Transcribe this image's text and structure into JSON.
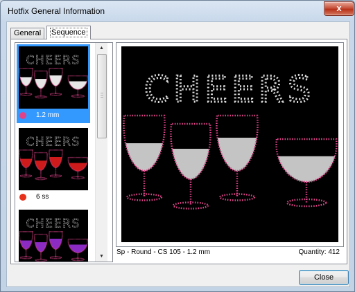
{
  "window": {
    "title": "Hotfix General Information",
    "close_glyph": "x"
  },
  "tabs": [
    {
      "label": "General",
      "active": false
    },
    {
      "label": "Sequence",
      "active": true
    }
  ],
  "thumbnails": [
    {
      "label": "1.2 mm",
      "dot_color": "#e0438a",
      "selected": true,
      "glass_fill": "#ffffff",
      "thumb_text": "CHEERS"
    },
    {
      "label": "6 ss",
      "dot_color": "#e8311a",
      "selected": false,
      "glass_fill": "#e31d1d",
      "thumb_text": "CHEERS"
    },
    {
      "label": "",
      "dot_color": "#9b30d9",
      "selected": false,
      "glass_fill": "#9b30d9",
      "thumb_text": "CHEERS"
    }
  ],
  "preview": {
    "text": "CHEERS",
    "text_color": "#d9d9d9",
    "outline_color": "#e0438a",
    "fill_color": "#d9d9d9"
  },
  "info": {
    "spec": "Sp - Round - CS 105 - 1.2 mm",
    "quantity": "Quantity: 412"
  },
  "buttons": {
    "close": "Close"
  },
  "icons": {
    "scroll_up": "scroll-up-arrow-icon",
    "scroll_down": "scroll-down-arrow-icon",
    "close": "close-window-icon"
  }
}
